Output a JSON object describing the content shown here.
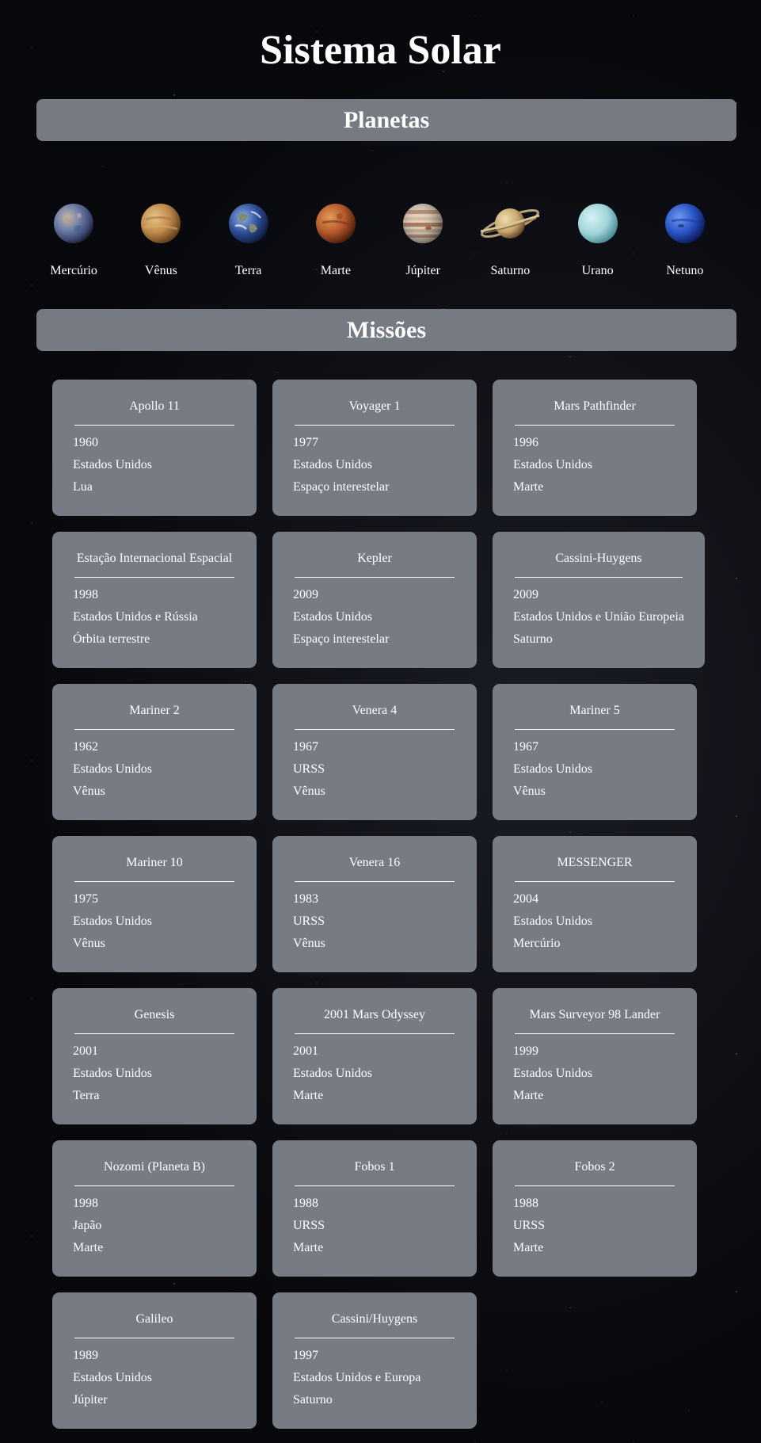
{
  "title": "Sistema Solar",
  "sections": {
    "planets": "Planetas",
    "missions": "Missões"
  },
  "planets": [
    {
      "name": "Mercúrio",
      "icon": "mercury-icon"
    },
    {
      "name": "Vênus",
      "icon": "venus-icon"
    },
    {
      "name": "Terra",
      "icon": "earth-icon"
    },
    {
      "name": "Marte",
      "icon": "mars-icon"
    },
    {
      "name": "Júpiter",
      "icon": "jupiter-icon"
    },
    {
      "name": "Saturno",
      "icon": "saturn-icon"
    },
    {
      "name": "Urano",
      "icon": "uranus-icon"
    },
    {
      "name": "Netuno",
      "icon": "neptune-icon"
    }
  ],
  "missions": [
    {
      "name": "Apollo 11",
      "year": "1960",
      "country": "Estados Unidos",
      "destination": "Lua"
    },
    {
      "name": "Voyager 1",
      "year": "1977",
      "country": "Estados Unidos",
      "destination": "Espaço interestelar"
    },
    {
      "name": "Mars Pathfinder",
      "year": "1996",
      "country": "Estados Unidos",
      "destination": "Marte"
    },
    {
      "name": "Estação Internacional Espacial",
      "year": "1998",
      "country": "Estados Unidos e Rússia",
      "destination": "Órbita terrestre"
    },
    {
      "name": "Kepler",
      "year": "2009",
      "country": "Estados Unidos",
      "destination": "Espaço interestelar"
    },
    {
      "name": "Cassini-Huygens",
      "year": "2009",
      "country": "Estados Unidos e União Europeia",
      "destination": "Saturno"
    },
    {
      "name": "Mariner 2",
      "year": "1962",
      "country": "Estados Unidos",
      "destination": "Vênus"
    },
    {
      "name": "Venera 4",
      "year": "1967",
      "country": "URSS",
      "destination": "Vênus"
    },
    {
      "name": "Mariner 5",
      "year": "1967",
      "country": "Estados Unidos",
      "destination": "Vênus"
    },
    {
      "name": "Mariner 10",
      "year": "1975",
      "country": "Estados Unidos",
      "destination": "Vênus"
    },
    {
      "name": "Venera 16",
      "year": "1983",
      "country": "URSS",
      "destination": "Vênus"
    },
    {
      "name": "MESSENGER",
      "year": "2004",
      "country": "Estados Unidos",
      "destination": "Mercúrio"
    },
    {
      "name": "Genesis",
      "year": "2001",
      "country": "Estados Unidos",
      "destination": "Terra"
    },
    {
      "name": "2001 Mars Odyssey",
      "year": "2001",
      "country": "Estados Unidos",
      "destination": "Marte"
    },
    {
      "name": "Mars Surveyor 98 Lander",
      "year": "1999",
      "country": "Estados Unidos",
      "destination": "Marte"
    },
    {
      "name": "Nozomi (Planeta B)",
      "year": "1998",
      "country": "Japão",
      "destination": "Marte"
    },
    {
      "name": "Fobos 1",
      "year": "1988",
      "country": "URSS",
      "destination": "Marte"
    },
    {
      "name": "Fobos 2",
      "year": "1988",
      "country": "URSS",
      "destination": "Marte"
    },
    {
      "name": "Galileo",
      "year": "1989",
      "country": "Estados Unidos",
      "destination": "Júpiter"
    },
    {
      "name": "Cassini/Huygens",
      "year": "1997",
      "country": "Estados Unidos e Europa",
      "destination": "Saturno"
    }
  ],
  "colors": {
    "panel": "#777b84",
    "background": "#07080c",
    "text": "#ffffff"
  }
}
